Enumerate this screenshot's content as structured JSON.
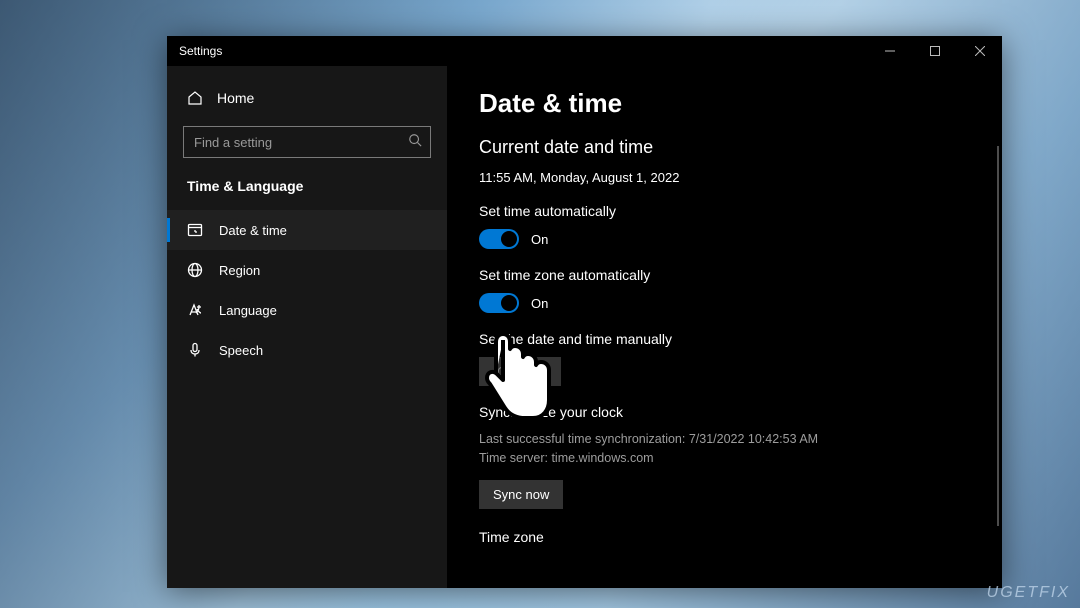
{
  "window": {
    "title": "Settings"
  },
  "sidebar": {
    "home": "Home",
    "search_placeholder": "Find a setting",
    "category": "Time & Language",
    "items": [
      {
        "label": "Date & time",
        "icon": "clock",
        "active": true
      },
      {
        "label": "Region",
        "icon": "globe",
        "active": false
      },
      {
        "label": "Language",
        "icon": "language",
        "active": false
      },
      {
        "label": "Speech",
        "icon": "mic",
        "active": false
      }
    ]
  },
  "main": {
    "heading": "Date & time",
    "subheading": "Current date and time",
    "current_datetime": "11:55 AM, Monday, August 1, 2022",
    "set_time_auto": {
      "label": "Set time automatically",
      "state": "On"
    },
    "set_tz_auto": {
      "label": "Set time zone automatically",
      "state": "On"
    },
    "set_manual": {
      "label": "Set the date and time manually",
      "button": "Change"
    },
    "sync": {
      "heading": "Synchronize your clock",
      "last": "Last successful time synchronization: 7/31/2022 10:42:53 AM",
      "server": "Time server: time.windows.com",
      "button": "Sync now"
    },
    "timezone_heading": "Time zone"
  },
  "watermark": "UGETFIX"
}
